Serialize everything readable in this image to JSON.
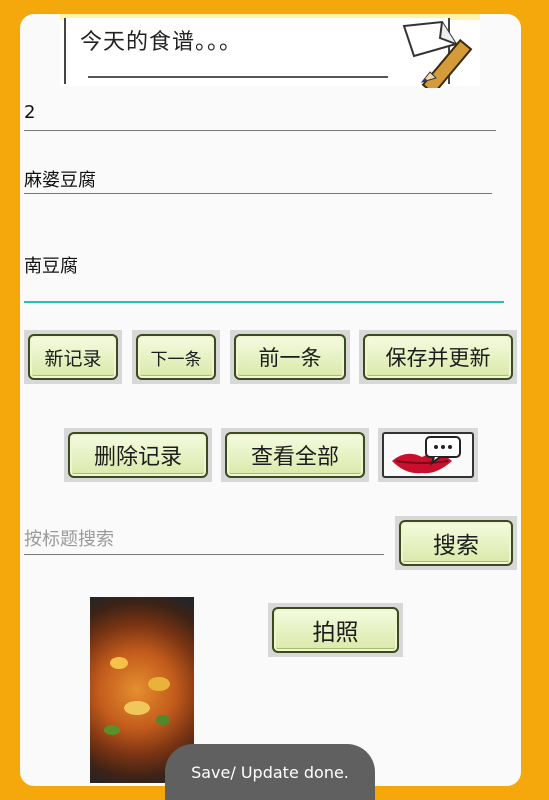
{
  "header": {
    "banner_text": "今天的食谱。。。"
  },
  "form": {
    "id_value": "2",
    "title_value": "麻婆豆腐",
    "content_value": "南豆腐"
  },
  "buttons": {
    "new_record": "新记录",
    "next": "下一条",
    "previous": "前一条",
    "save_update": "保存并更新",
    "delete_record": "删除记录",
    "view_all": "查看全部",
    "search": "搜索",
    "take_photo": "拍照"
  },
  "search": {
    "placeholder": "按标题搜索"
  },
  "toast": {
    "message": "Save/ Update done."
  },
  "colors": {
    "frame": "#f5a80c",
    "active_underline": "#1fc4b8",
    "button_face": "#e4efbf"
  }
}
